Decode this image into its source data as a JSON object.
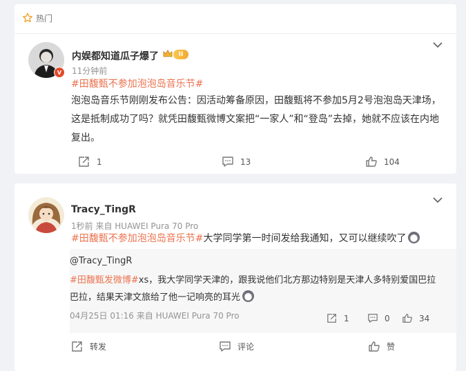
{
  "hot_section": {
    "label": "热门"
  },
  "post1": {
    "author": "内娱都知道瓜子爆了",
    "badge": "II",
    "time": "11分钟前",
    "topic": "#田馥甄不参加泡泡岛音乐节#",
    "text": "泡泡岛音乐节刚刚发布公告：因活动筹备原因，田馥甄将不参加5月2号泡泡岛天津场，这是抵制成功了吗？就凭田馥甄微博文案把“一家人”和“登岛”去掉，她就不应该在内地复出。",
    "reposts": "1",
    "comments": "13",
    "likes": "104"
  },
  "post2": {
    "author": "Tracy_TingR",
    "meta": "1秒前  来自 HUAWEI Pura 70 Pro",
    "topic": "#田馥甄不参加泡泡岛音乐节#",
    "text": "大学同学第一时间发给我通知，又可以继续吹了",
    "quote": {
      "author": "@Tracy_TingR",
      "topic": "#田馥甄发微博#",
      "text": "xs，我大学同学天津的，跟我说他们北方那边特别是天津人多特别爱国巴拉巴拉，结果天津文旅给了他一记响亮的耳光",
      "meta": "04月25日 01:16  来自 HUAWEI Pura 70 Pro",
      "reposts": "1",
      "comments": "0",
      "likes": "34"
    },
    "actions": {
      "repost": "转发",
      "comment": "评论",
      "like": "赞"
    }
  },
  "colors": {
    "topic": "#eb7350",
    "accent_star": "#f1a32c",
    "verified": "#e24a2a"
  }
}
